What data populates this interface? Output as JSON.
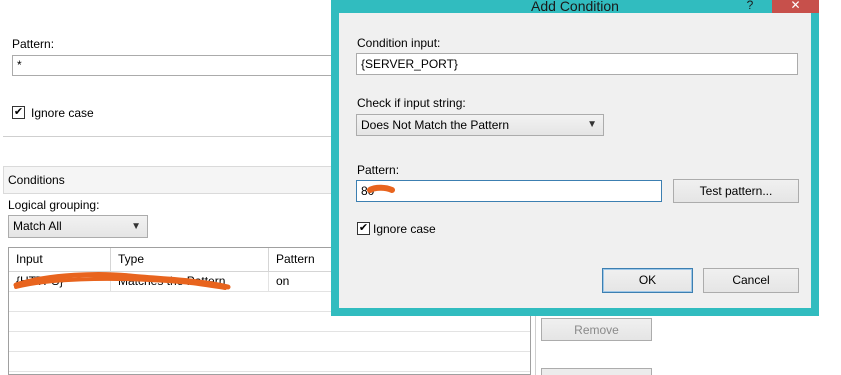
{
  "background": {
    "pattern_label": "Pattern:",
    "pattern_value": "*",
    "ignore_case_label": "Ignore case",
    "ignore_case_checked": true,
    "conditions_title": "Conditions",
    "logical_grouping_label": "Logical grouping:",
    "logical_grouping_value": "Match All",
    "grid": {
      "columns": [
        "Input",
        "Type",
        "Pattern"
      ],
      "rows": [
        {
          "input": "{HTTPS}",
          "type": "Matches the Pattern",
          "pattern": "on"
        }
      ]
    },
    "remove_button": "Remove"
  },
  "dialog": {
    "title": "Add Condition",
    "help_glyph": "?",
    "close_glyph": "✕",
    "condition_input_label": "Condition input:",
    "condition_input_value": "{SERVER_PORT}",
    "check_label": "Check if input string:",
    "check_value": "Does Not Match the Pattern",
    "pattern_label": "Pattern:",
    "pattern_value": "80",
    "test_pattern_button": "Test pattern...",
    "ignore_case_label": "Ignore case",
    "ignore_case_checked": true,
    "ok_button": "OK",
    "cancel_button": "Cancel"
  },
  "colors": {
    "dialog_frame": "#31bcbf",
    "close_button": "#c7504b",
    "redaction": "#e8641e"
  }
}
